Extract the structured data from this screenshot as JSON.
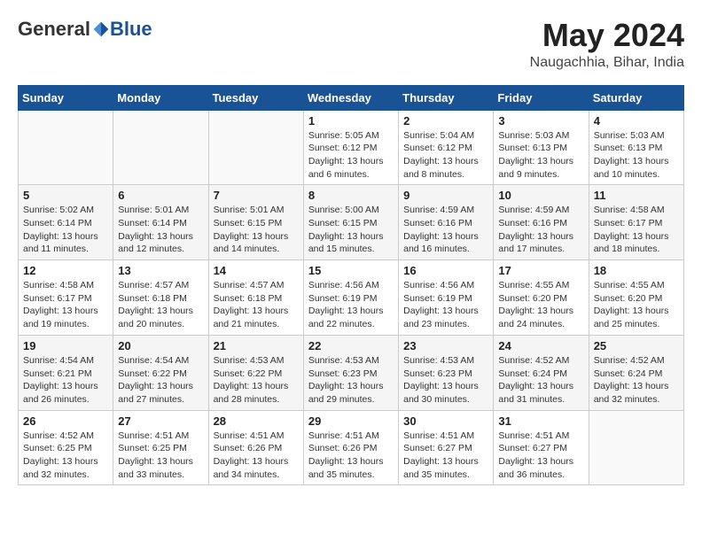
{
  "header": {
    "logo_general": "General",
    "logo_blue": "Blue",
    "title": "May 2024",
    "location": "Naugachhia, Bihar, India"
  },
  "days_of_week": [
    "Sunday",
    "Monday",
    "Tuesday",
    "Wednesday",
    "Thursday",
    "Friday",
    "Saturday"
  ],
  "weeks": [
    [
      {
        "day": "",
        "info": ""
      },
      {
        "day": "",
        "info": ""
      },
      {
        "day": "",
        "info": ""
      },
      {
        "day": "1",
        "info": "Sunrise: 5:05 AM\nSunset: 6:12 PM\nDaylight: 13 hours and 6 minutes."
      },
      {
        "day": "2",
        "info": "Sunrise: 5:04 AM\nSunset: 6:12 PM\nDaylight: 13 hours and 8 minutes."
      },
      {
        "day": "3",
        "info": "Sunrise: 5:03 AM\nSunset: 6:13 PM\nDaylight: 13 hours and 9 minutes."
      },
      {
        "day": "4",
        "info": "Sunrise: 5:03 AM\nSunset: 6:13 PM\nDaylight: 13 hours and 10 minutes."
      }
    ],
    [
      {
        "day": "5",
        "info": "Sunrise: 5:02 AM\nSunset: 6:14 PM\nDaylight: 13 hours and 11 minutes."
      },
      {
        "day": "6",
        "info": "Sunrise: 5:01 AM\nSunset: 6:14 PM\nDaylight: 13 hours and 12 minutes."
      },
      {
        "day": "7",
        "info": "Sunrise: 5:01 AM\nSunset: 6:15 PM\nDaylight: 13 hours and 14 minutes."
      },
      {
        "day": "8",
        "info": "Sunrise: 5:00 AM\nSunset: 6:15 PM\nDaylight: 13 hours and 15 minutes."
      },
      {
        "day": "9",
        "info": "Sunrise: 4:59 AM\nSunset: 6:16 PM\nDaylight: 13 hours and 16 minutes."
      },
      {
        "day": "10",
        "info": "Sunrise: 4:59 AM\nSunset: 6:16 PM\nDaylight: 13 hours and 17 minutes."
      },
      {
        "day": "11",
        "info": "Sunrise: 4:58 AM\nSunset: 6:17 PM\nDaylight: 13 hours and 18 minutes."
      }
    ],
    [
      {
        "day": "12",
        "info": "Sunrise: 4:58 AM\nSunset: 6:17 PM\nDaylight: 13 hours and 19 minutes."
      },
      {
        "day": "13",
        "info": "Sunrise: 4:57 AM\nSunset: 6:18 PM\nDaylight: 13 hours and 20 minutes."
      },
      {
        "day": "14",
        "info": "Sunrise: 4:57 AM\nSunset: 6:18 PM\nDaylight: 13 hours and 21 minutes."
      },
      {
        "day": "15",
        "info": "Sunrise: 4:56 AM\nSunset: 6:19 PM\nDaylight: 13 hours and 22 minutes."
      },
      {
        "day": "16",
        "info": "Sunrise: 4:56 AM\nSunset: 6:19 PM\nDaylight: 13 hours and 23 minutes."
      },
      {
        "day": "17",
        "info": "Sunrise: 4:55 AM\nSunset: 6:20 PM\nDaylight: 13 hours and 24 minutes."
      },
      {
        "day": "18",
        "info": "Sunrise: 4:55 AM\nSunset: 6:20 PM\nDaylight: 13 hours and 25 minutes."
      }
    ],
    [
      {
        "day": "19",
        "info": "Sunrise: 4:54 AM\nSunset: 6:21 PM\nDaylight: 13 hours and 26 minutes."
      },
      {
        "day": "20",
        "info": "Sunrise: 4:54 AM\nSunset: 6:22 PM\nDaylight: 13 hours and 27 minutes."
      },
      {
        "day": "21",
        "info": "Sunrise: 4:53 AM\nSunset: 6:22 PM\nDaylight: 13 hours and 28 minutes."
      },
      {
        "day": "22",
        "info": "Sunrise: 4:53 AM\nSunset: 6:23 PM\nDaylight: 13 hours and 29 minutes."
      },
      {
        "day": "23",
        "info": "Sunrise: 4:53 AM\nSunset: 6:23 PM\nDaylight: 13 hours and 30 minutes."
      },
      {
        "day": "24",
        "info": "Sunrise: 4:52 AM\nSunset: 6:24 PM\nDaylight: 13 hours and 31 minutes."
      },
      {
        "day": "25",
        "info": "Sunrise: 4:52 AM\nSunset: 6:24 PM\nDaylight: 13 hours and 32 minutes."
      }
    ],
    [
      {
        "day": "26",
        "info": "Sunrise: 4:52 AM\nSunset: 6:25 PM\nDaylight: 13 hours and 32 minutes."
      },
      {
        "day": "27",
        "info": "Sunrise: 4:51 AM\nSunset: 6:25 PM\nDaylight: 13 hours and 33 minutes."
      },
      {
        "day": "28",
        "info": "Sunrise: 4:51 AM\nSunset: 6:26 PM\nDaylight: 13 hours and 34 minutes."
      },
      {
        "day": "29",
        "info": "Sunrise: 4:51 AM\nSunset: 6:26 PM\nDaylight: 13 hours and 35 minutes."
      },
      {
        "day": "30",
        "info": "Sunrise: 4:51 AM\nSunset: 6:27 PM\nDaylight: 13 hours and 35 minutes."
      },
      {
        "day": "31",
        "info": "Sunrise: 4:51 AM\nSunset: 6:27 PM\nDaylight: 13 hours and 36 minutes."
      },
      {
        "day": "",
        "info": ""
      }
    ]
  ]
}
